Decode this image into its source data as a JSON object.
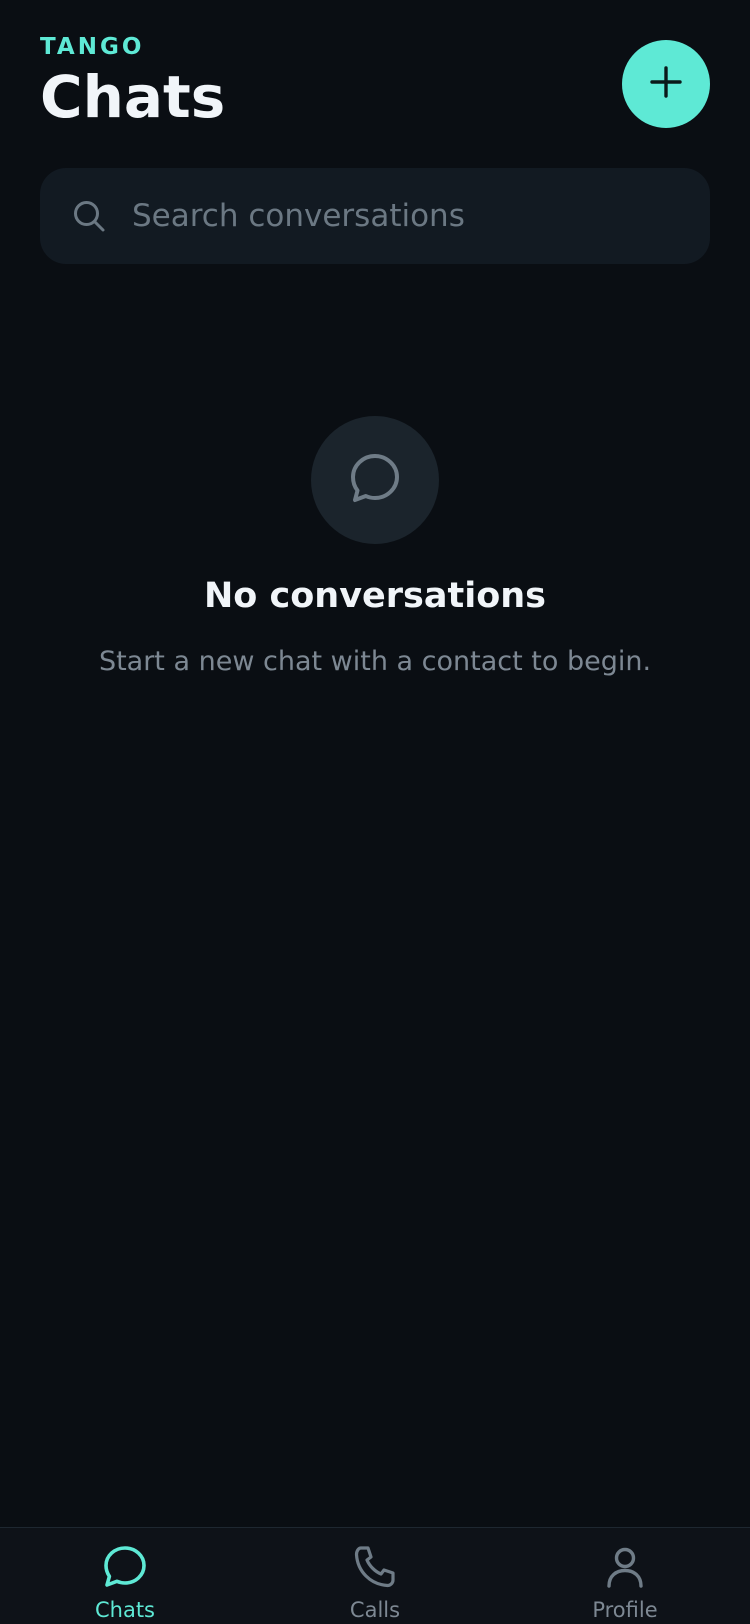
{
  "header": {
    "brand": "TANGO",
    "title": "Chats",
    "new_chat_icon": "plus-icon"
  },
  "search": {
    "placeholder": "Search conversations",
    "value": "",
    "icon": "search-icon"
  },
  "empty_state": {
    "icon": "chat-bubble-icon",
    "title": "No conversations",
    "subtitle": "Start a new chat with a contact to begin."
  },
  "tabbar": {
    "items": [
      {
        "label": "Chats",
        "icon": "chat-bubble-icon",
        "active": true
      },
      {
        "label": "Calls",
        "icon": "phone-icon",
        "active": false
      },
      {
        "label": "Profile",
        "icon": "person-icon",
        "active": false
      }
    ]
  },
  "colors": {
    "background": "#0a0e13",
    "accent": "#5ee9d5",
    "surface": "#121a22",
    "muted_text": "#7d8893"
  }
}
